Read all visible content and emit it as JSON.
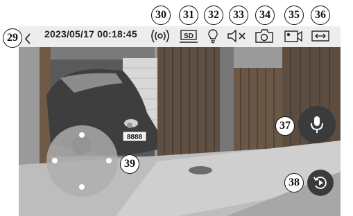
{
  "statusbar": {
    "timestamp": "2023/05/17 00:18:45",
    "sd_label": "SD"
  },
  "callouts": {
    "back": "29",
    "audio_wave": "30",
    "sd_card": "31",
    "light": "32",
    "mute": "33",
    "snapshot": "34",
    "record": "35",
    "fullscreen": "36",
    "talk": "37",
    "playback": "38",
    "ptz": "39"
  },
  "scene": {
    "license_plate": "8888"
  },
  "icons": {
    "back": "chevron-left-icon",
    "audio_wave": "audio-wave-icon",
    "sd_card": "sd-card-icon",
    "light": "light-bulb-icon",
    "mute": "speaker-mute-icon",
    "snapshot": "camera-icon",
    "record": "video-record-icon",
    "fullscreen": "fullscreen-icon",
    "talk": "microphone-icon",
    "playback": "playback-icon"
  },
  "colors": {
    "button_dark": "#3b3b3b",
    "bar_bg": "#f8f8f8",
    "joystick": "#afafaf"
  }
}
